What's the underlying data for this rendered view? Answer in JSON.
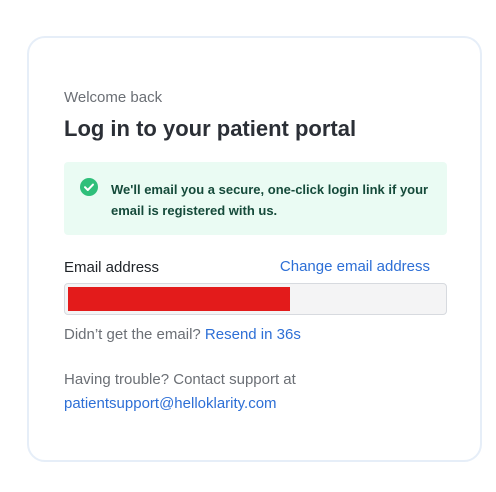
{
  "header": {
    "eyebrow": "Welcome back",
    "title": "Log in to your patient portal"
  },
  "alert": {
    "icon": "check-circle-icon",
    "message": "We'll email you a secure, one-click login link if your email is registered with us.",
    "background_color": "#eafbf3",
    "icon_color": "#2fbf7a"
  },
  "email_field": {
    "label": "Email address",
    "change_link": "Change email address",
    "value": "",
    "redacted": true
  },
  "resend": {
    "prompt": "Didn’t get the email?",
    "link": "Resend in 36s"
  },
  "support": {
    "prompt": "Having trouble? Contact support at",
    "email": "patientsupport@helloklarity.com"
  },
  "colors": {
    "link": "#2d6fd6",
    "title": "#2b2f36",
    "muted": "#6b6f75"
  }
}
